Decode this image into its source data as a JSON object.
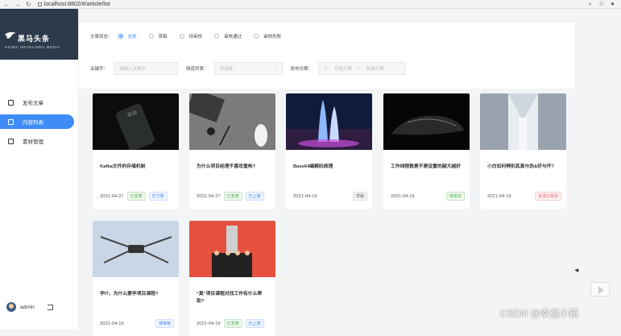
{
  "browser": {
    "url": "localhost:8802/#/article/list"
  },
  "logo": {
    "brand": "黑马头条",
    "subtitle": "HEIMA HEADLINES MEDIA"
  },
  "menu": [
    {
      "label": "发布文章",
      "icon": "edit-icon",
      "active": false
    },
    {
      "label": "内容列表",
      "icon": "list-icon",
      "active": true
    },
    {
      "label": "素材管理",
      "icon": "image-icon",
      "active": false
    }
  ],
  "user": {
    "name": "admin"
  },
  "filter": {
    "status_label": "文章状态：",
    "status_options": [
      "全部",
      "草稿",
      "待审核",
      "审核通过",
      "审核失败"
    ],
    "status_selected": 0,
    "keyword_label": "关键字：",
    "keyword_placeholder": "请输入关键字",
    "channel_label": "频道列表：",
    "channel_placeholder": "请选择",
    "date_label": "发布日期：",
    "date_start": "开始日期",
    "date_sep": "-",
    "date_end": "结束日期"
  },
  "cards": [
    {
      "title": "Kafka文件的存储机制",
      "date": "2021-04-27",
      "tags": [
        {
          "text": "已发表",
          "color": "green"
        },
        {
          "text": "已下架",
          "color": "blue"
        }
      ],
      "image": "phone"
    },
    {
      "title": "为什么项目经理不喜欢重构?",
      "date": "2021-04-27",
      "tags": [
        {
          "text": "已发表",
          "color": "green"
        },
        {
          "text": "已上架",
          "color": "blue"
        }
      ],
      "image": "desk"
    },
    {
      "title": "Base64编解码原理",
      "date": "2021-04-19",
      "tags": [
        {
          "text": "草稿",
          "color": "gray"
        }
      ],
      "image": "city"
    },
    {
      "title": "工作线程数是不是设置的越大越好",
      "date": "2021-04-19",
      "tags": [
        {
          "text": "待发布",
          "color": "green"
        }
      ],
      "image": "car"
    },
    {
      "title": "小白如何辨别其真与伪&好与坏?",
      "date": "2021-04-19",
      "tags": [
        {
          "text": "未通过审核",
          "color": "red"
        }
      ],
      "image": "server"
    },
    {
      "title": "学IT，为什么要学项目课程?",
      "date": "2021-04-19",
      "tags": [
        {
          "text": "待审核",
          "color": "blue"
        }
      ],
      "image": "drone"
    },
    {
      "title": "“真”项目课程对找工作有什么帮助?",
      "date": "2021-04-19",
      "tags": [
        {
          "text": "已发表",
          "color": "green"
        },
        {
          "text": "已上架",
          "color": "blue"
        }
      ],
      "image": "people"
    }
  ],
  "watermark": "CSDN @幸运小新"
}
